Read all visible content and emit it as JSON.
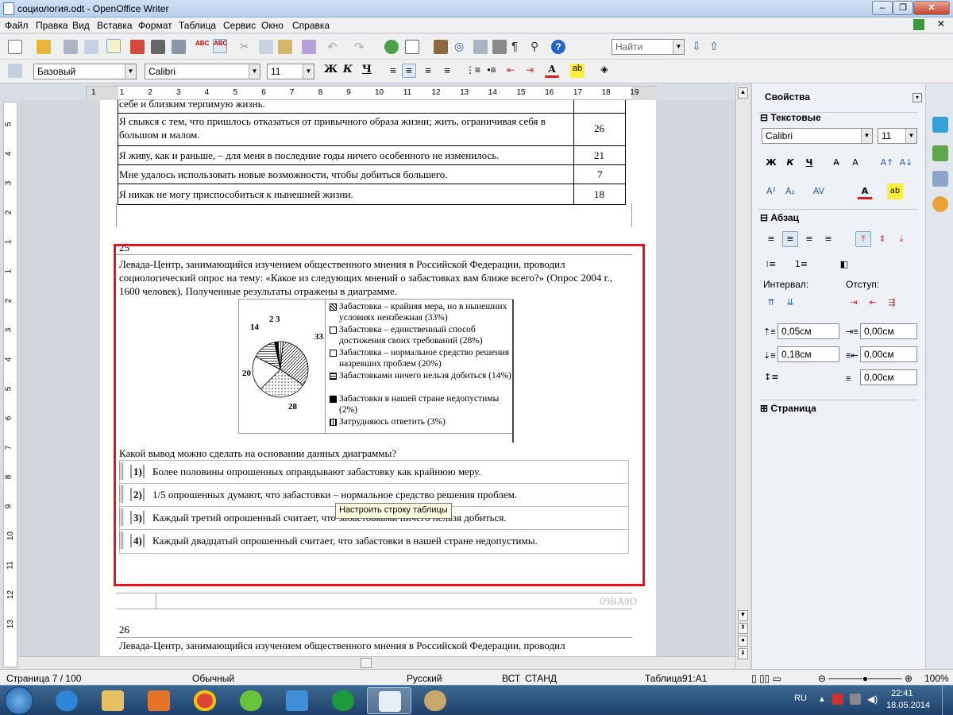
{
  "window": {
    "title": "социология.odt - OpenOffice Writer"
  },
  "menu": [
    "Файл",
    "Правка",
    "Вид",
    "Вставка",
    "Формат",
    "Таблица",
    "Сервис",
    "Окно",
    "Справка"
  ],
  "toolbar": {
    "search_placeholder": "Найти",
    "style": "Базовый",
    "font": "Calibri",
    "size": "11",
    "bold": "Ж",
    "italic": "К",
    "underline": "Ч"
  },
  "ruler": {
    "ticks": [
      "1",
      "1",
      "2",
      "3",
      "4",
      "5",
      "6",
      "7",
      "8",
      "9",
      "10",
      "11",
      "12",
      "13",
      "14",
      "15",
      "16",
      "17",
      "18",
      "19"
    ]
  },
  "vruler": {
    "ticks": [
      "5",
      "4",
      "3",
      "2",
      "1",
      "1",
      "2",
      "3",
      "4",
      "5",
      "6",
      "7",
      "8",
      "9",
      "10",
      "11",
      "12",
      "13"
    ]
  },
  "doc": {
    "prev_rows": [
      {
        "text": "себе и близким терпимую жизнь.",
        "num": "28"
      },
      {
        "text": "Я свыкся с тем, что пришлось отказаться от привычного образа жизни; жить, ограничивая себя в большом и малом.",
        "num": "26"
      },
      {
        "text": "Я живу, как и раньше, – для меня в последние годы ничего особенного не изменилось.",
        "num": "21"
      },
      {
        "text": "Мне удалось использовать новые возможности, чтобы добиться большего.",
        "num": "7"
      },
      {
        "text": "Я никак не могу приспособиться к нынешней жизни.",
        "num": "18"
      }
    ],
    "q25": {
      "number": "25",
      "intro": "Левада-Центр, занимающийся изучением общественного мнения в Российской Федерации, проводил социологический опрос на тему: «Какое из следующих мнений о забастовках вам ближе всего?» (Опрос 2004 г., 1600 человек). Полученные результаты отражены в диаграмме.",
      "question": "Какой вывод можно сделать на основании данных диаграммы?",
      "answers": [
        {
          "n": "1)",
          "text": "Более половины опрошенных оправдывают забастовку как крайнюю меру."
        },
        {
          "n": "2)",
          "text": "1/5 опрошенных думают, что забастовки – нормальное средство решения проблем."
        },
        {
          "n": "3)",
          "text": "Каждый третий опрошенный считает, что забастовками ничего нельзя добиться."
        },
        {
          "n": "4)",
          "text": "Каждый двадцатый опрошенный считает, что забастовки в нашей стране недопустимы."
        }
      ]
    },
    "code": "09BA9D",
    "q26": {
      "number": "26",
      "intro": "Левада-Центр, занимающийся изучением общественного мнения в Российской Федерации, проводил"
    }
  },
  "tooltip": "Настроить строку таблицы",
  "chart_data": {
    "type": "pie",
    "values": [
      33,
      28,
      20,
      14,
      2,
      3
    ],
    "labels": [
      "33",
      "28",
      "20",
      "14",
      "2",
      "3"
    ],
    "legend": [
      "Забастовка – крайняя мера, но в нынешних условиях неизбежная (33%)",
      "Забастовка – единственный способ достижения своих требований (28%)",
      "Забастовка – нормальное средство решения назревших проблем (20%)",
      "Забастовками ничего нельзя добиться (14%)",
      "Забастовки в нашей стране недопустимы (2%)",
      "Затрудняюсь ответить (3%)"
    ]
  },
  "sidebar": {
    "title": "Свойства",
    "text_section": "Текстовые",
    "font": "Calibri",
    "size": "11",
    "para_section": "Абзац",
    "interval": "Интервал:",
    "indent": "Отступ:",
    "above": "0,05см",
    "below": "0,18см",
    "indent_before": "0,00см",
    "indent_after": "0,00см",
    "first_line": "0,00см",
    "page_section": "Страница"
  },
  "status": {
    "page": "Страница  7 / 100",
    "style": "Обычный",
    "lang": "Русский",
    "mode1": "ВСТ",
    "mode2": "СТАНД",
    "table": "Таблица91:A1",
    "zoom": "100%"
  },
  "tray": {
    "lang": "RU",
    "time": "22:41",
    "date": "18.05.2014"
  }
}
